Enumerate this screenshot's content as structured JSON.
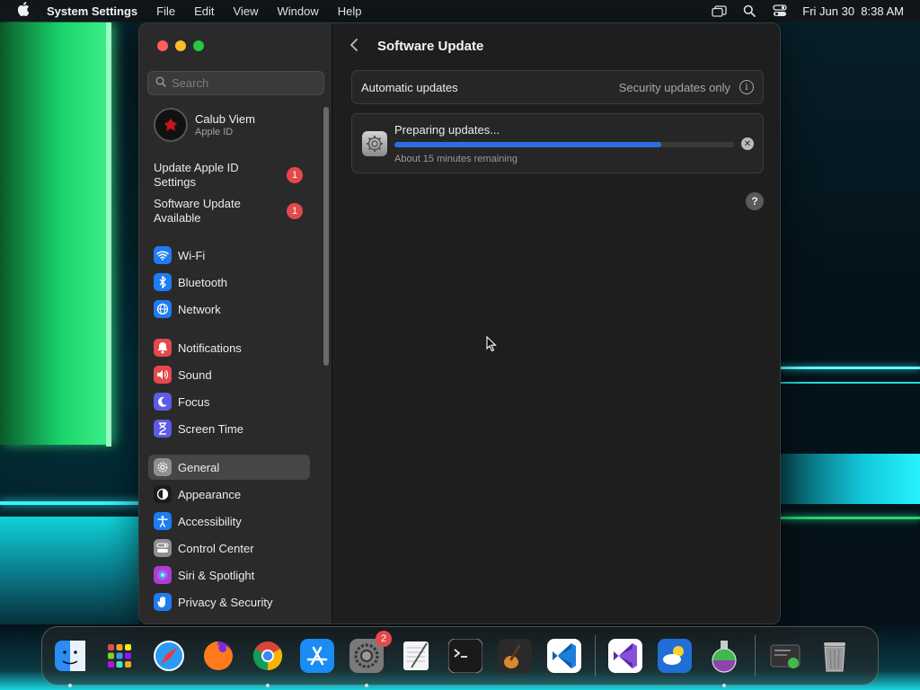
{
  "menubar": {
    "app_name": "System Settings",
    "menus": [
      "File",
      "Edit",
      "View",
      "Window",
      "Help"
    ],
    "datetime": "Fri Jun 30  8:38 AM"
  },
  "sidebar": {
    "search_placeholder": "Search",
    "account": {
      "name": "Calub Viem",
      "subtitle": "Apple ID"
    },
    "notices": [
      {
        "label": "Update Apple ID Settings",
        "badge": "1"
      },
      {
        "label": "Software Update Available",
        "badge": "1"
      }
    ],
    "items": [
      {
        "label": "Wi-Fi",
        "icon": "wifi-icon",
        "color": "#1e7cf2"
      },
      {
        "label": "Bluetooth",
        "icon": "bluetooth-icon",
        "color": "#1e7cf2"
      },
      {
        "label": "Network",
        "icon": "globe-icon",
        "color": "#1e7cf2"
      },
      {
        "label": "Notifications",
        "icon": "bell-icon",
        "color": "#e5484d"
      },
      {
        "label": "Sound",
        "icon": "speaker-icon",
        "color": "#e5484d"
      },
      {
        "label": "Focus",
        "icon": "moon-icon",
        "color": "#5e5ce6"
      },
      {
        "label": "Screen Time",
        "icon": "hourglass-icon",
        "color": "#5e5ce6"
      },
      {
        "label": "General",
        "icon": "gear-icon",
        "color": "#8e8e93",
        "selected": true
      },
      {
        "label": "Appearance",
        "icon": "appearance-icon",
        "color": "#1c1c1e"
      },
      {
        "label": "Accessibility",
        "icon": "accessibility-icon",
        "color": "#1e7cf2"
      },
      {
        "label": "Control Center",
        "icon": "control-center-icon",
        "color": "#8e8e93"
      },
      {
        "label": "Siri & Spotlight",
        "icon": "siri-icon",
        "color": "#b03bd4"
      },
      {
        "label": "Privacy & Security",
        "icon": "hand-icon",
        "color": "#1e7cf2"
      }
    ]
  },
  "content": {
    "title": "Software Update",
    "automatic_updates": {
      "label": "Automatic updates",
      "value": "Security updates only"
    },
    "progress": {
      "title": "Preparing updates...",
      "remaining": "About 15 minutes remaining",
      "fraction": 0.785
    }
  },
  "dock": {
    "apps": [
      {
        "name": "finder-icon",
        "color": "#2a8cf4"
      },
      {
        "name": "launchpad-icon",
        "color": "#d9d9d9"
      },
      {
        "name": "safari-icon",
        "color": "#2a9bf4"
      },
      {
        "name": "firefox-icon",
        "color": "#ff7a1a"
      },
      {
        "name": "chrome-icon",
        "color": "#f4f4f4"
      },
      {
        "name": "app-store-icon",
        "color": "#1a8cf4"
      },
      {
        "name": "system-settings-icon",
        "color": "#8a8a8a",
        "badge": "2"
      },
      {
        "name": "textedit-icon",
        "color": "#f4f4f4"
      },
      {
        "name": "terminal-icon",
        "color": "#1a1a1a"
      },
      {
        "name": "garageband-icon",
        "color": "#2a2a2a"
      },
      {
        "name": "vscode-icon",
        "color": "#1e7fd8"
      },
      {
        "name": "visual-studio-icon",
        "color": "#f4f4f4"
      },
      {
        "name": "weather-icon",
        "color": "#1f6fd6"
      },
      {
        "name": "flask-app-icon",
        "color": "#7a6a9a"
      },
      {
        "name": "downloads-stack-icon",
        "color": "#333333"
      },
      {
        "name": "trash-icon",
        "color": "#9a9a9a"
      }
    ]
  }
}
